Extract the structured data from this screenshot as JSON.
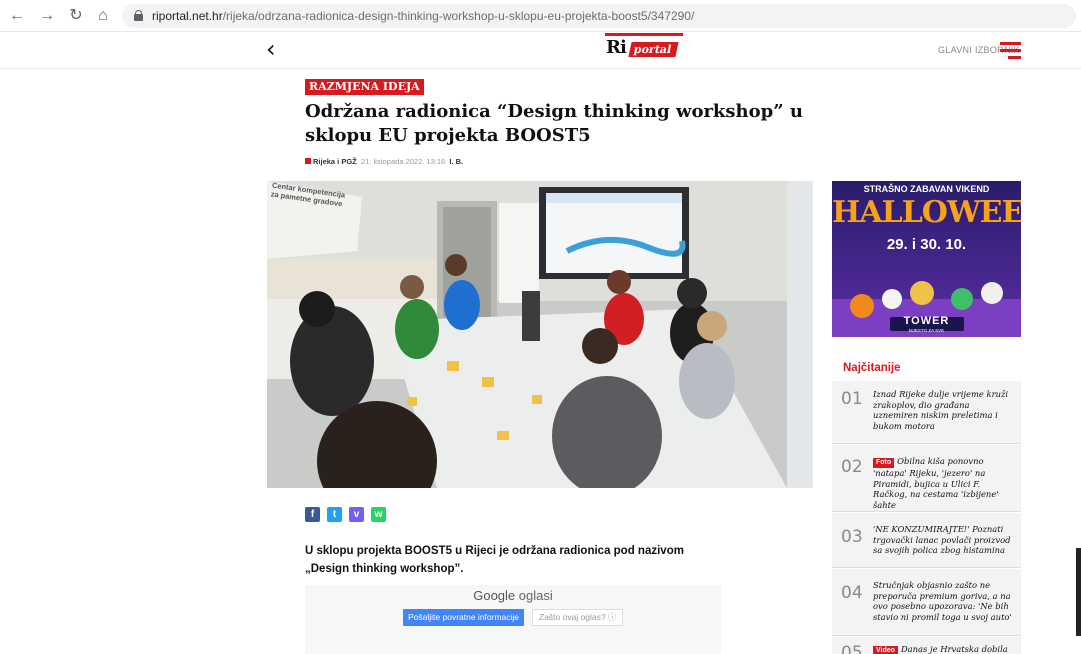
{
  "browser": {
    "url_host": "riportal.net.hr",
    "url_path": "/rijeka/odrzana-radionica-design-thinking-workshop-u-sklopu-eu-projekta-boost5/347290/"
  },
  "header": {
    "logo_ri": "Ri",
    "logo_portal": "portal",
    "menu_label": "GLAVNI IZBORNIK"
  },
  "article": {
    "tag": "RAZMJENA IDEJA",
    "title": "Održana radionica “Design thinking workshop” u sklopu EU projekta BOOST5",
    "category": "Rijeka i PGŽ",
    "date": "21. listopada 2022. 13:16",
    "author": "I. B.",
    "photo_sign": "Centar kompetencija za pametne gradove",
    "lead": "U sklopu projekta BOOST5 u Rijeci je održana radionica pod nazivom „Design thinking workshop”."
  },
  "share": [
    {
      "name": "facebook",
      "glyph": "f",
      "color": "#3b5998"
    },
    {
      "name": "twitter",
      "glyph": "t",
      "color": "#1da1f2"
    },
    {
      "name": "viber",
      "glyph": "v",
      "color": "#7360f2"
    },
    {
      "name": "whatsapp",
      "glyph": "w",
      "color": "#25d366"
    }
  ],
  "ad": {
    "google": "Google",
    "oglasi": "oglasi",
    "feedback_btn": "Pošaljite povratne informacije",
    "why_btn": "Zašto ovaj oglas? ⓘ"
  },
  "banner": {
    "top_text": "STRAŠNO ZABAVAN VIKEND",
    "title": "HALLOWEEN",
    "dates": "29. i 30. 10.",
    "brand": "TOWER",
    "brand_sub": "MJESTO ZA SVE"
  },
  "most_read": {
    "title": "Najčitanije",
    "items": [
      {
        "num": "01",
        "badge": "",
        "text": "Iznad Rijeke dulje vrijeme kruži zrakoplov, dio građana uznemiren niskim preletima i bukom motora"
      },
      {
        "num": "02",
        "badge": "Foto",
        "text": "Obilna kiša ponovno 'natapa' Rijeku, 'jezero' na Piramidi, bujica u Ulici F. Račkog, na cestama 'izbijene' šahte"
      },
      {
        "num": "03",
        "badge": "",
        "text": "'NE KONZUMIRAJTE!' Poznati trgovački lanac povlači proizvod sa svojih polica zbog histamina"
      },
      {
        "num": "04",
        "badge": "",
        "text": "Stručnjak objasnio zašto ne preporuča premium goriva, a na ovo posebno upozorava: 'Ne bih stavio ni promil toga u svoj auto'"
      },
      {
        "num": "05",
        "badge": "Video",
        "text": "Danas je Hrvatska dobila"
      }
    ]
  },
  "colors": {
    "accent": "#d71920"
  }
}
